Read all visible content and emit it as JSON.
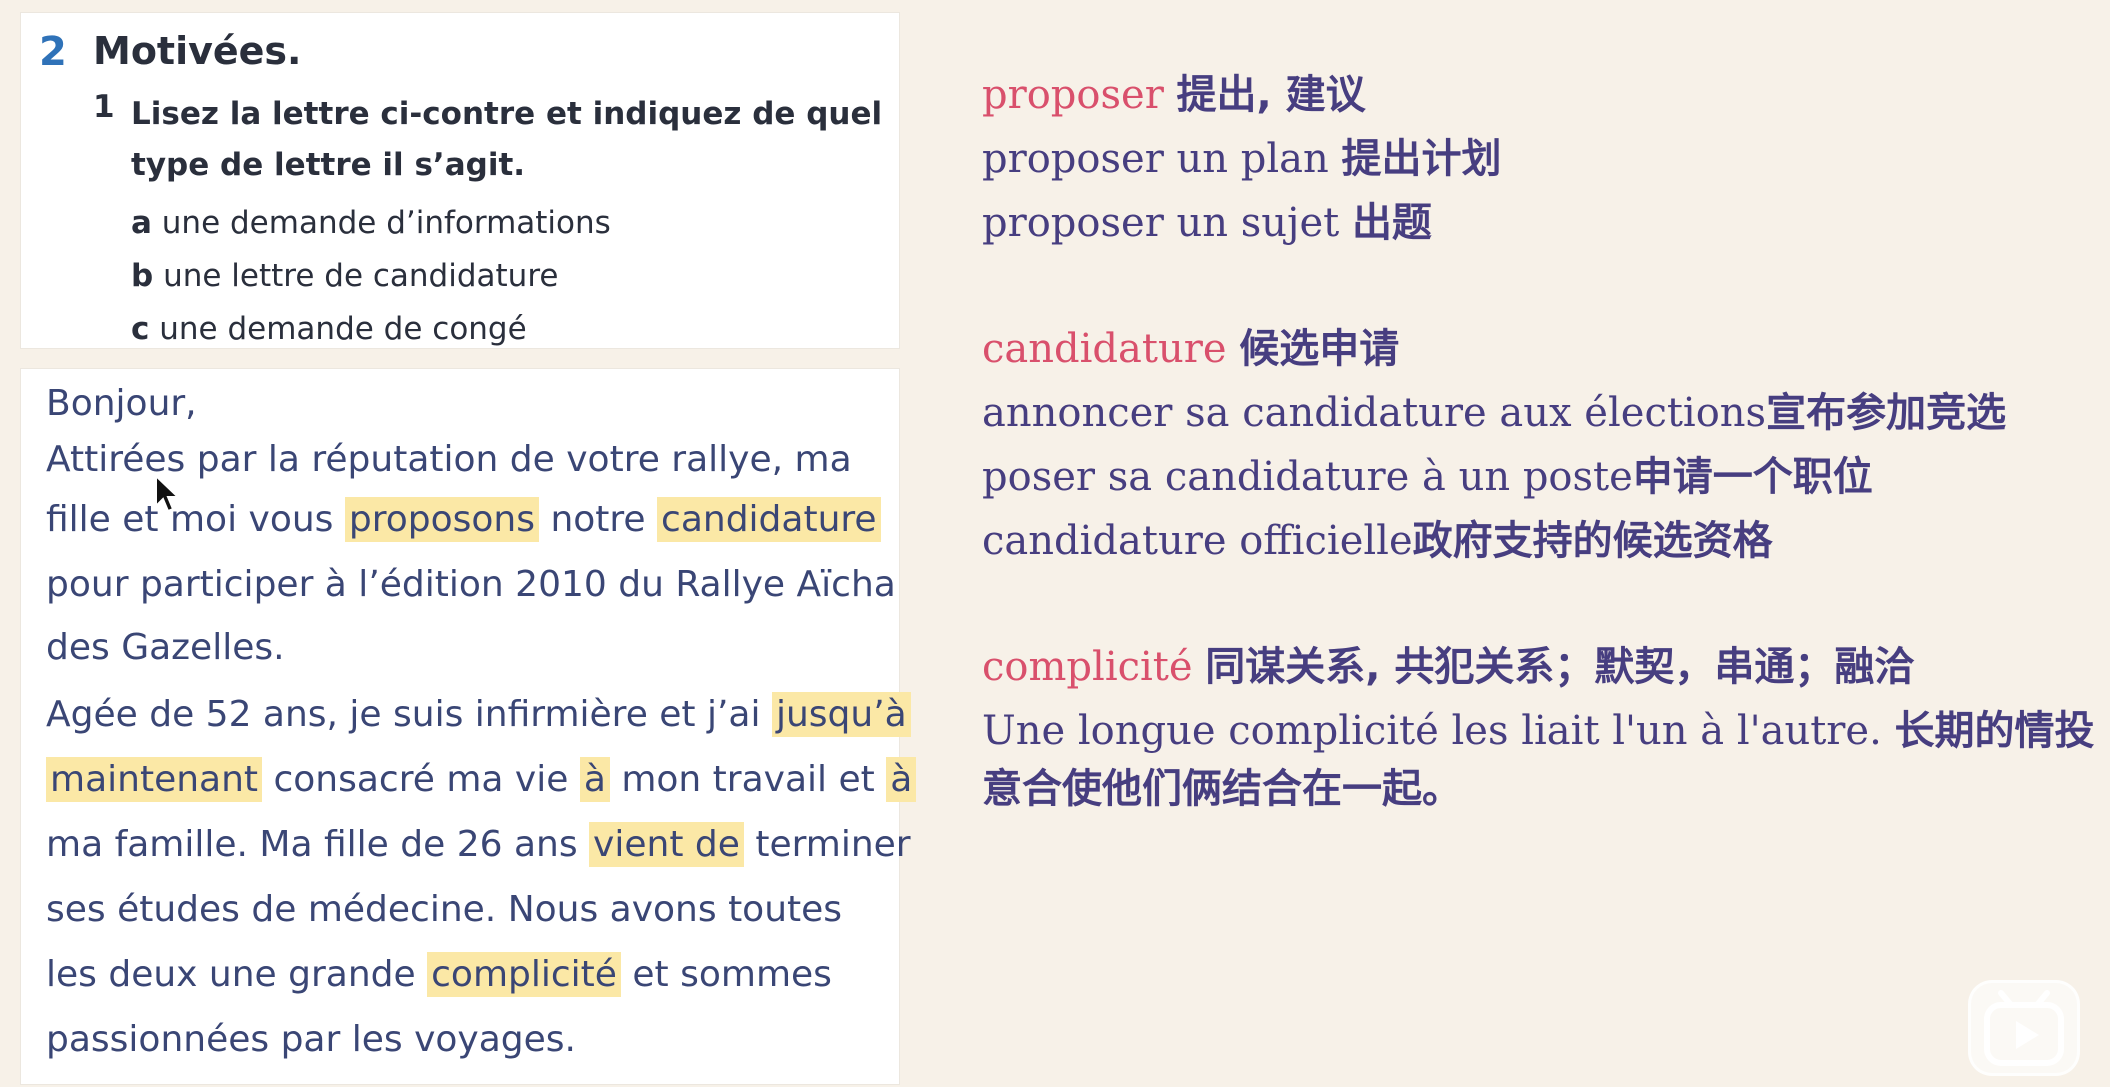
{
  "exercise": {
    "number": "2",
    "title": "Motivées.",
    "question_number": "1",
    "question_text": "Lisez la lettre ci-contre et indiquez de quel type de lettre il s’agit.",
    "options": [
      {
        "letter": "a",
        "text": "une demande d’informations"
      },
      {
        "letter": "b",
        "text": "une lettre de candidature"
      },
      {
        "letter": "c",
        "text": "une demande de congé"
      }
    ]
  },
  "letter": {
    "l1": "Bonjour,",
    "l2": "Attirées par la réputation de votre rallye, ma",
    "l3a": "fille et moi vous",
    "l3b": "proposons",
    "l3c": "notre",
    "l3d": "candidature",
    "l4": "pour participer à l’édition 2010 du Rallye Aïcha",
    "l5": "des Gazelles.",
    "l6a": "Agée de 52 ans, je suis infirmière et j’ai",
    "l6b": "jusqu’à",
    "l7a": "maintenant",
    "l7b": "consacré ma vie",
    "l7c": "à",
    "l7d": "mon travail et",
    "l7e": "à",
    "l8a": "ma famille. Ma fille de 26 ans",
    "l8b": "vient de",
    "l8c": "terminer",
    "l9": "ses études de médecine. Nous avons toutes",
    "l10a": "les deux une grande",
    "l10b": "complicité",
    "l10c": "et sommes",
    "l11": "passionnées par les voyages."
  },
  "vocab": {
    "proposer": {
      "word": "proposer",
      "meaning": "提出, 建议",
      "ex1_fr": "proposer un plan",
      "ex1_zh": "提出计划",
      "ex2_fr": "proposer un sujet",
      "ex2_zh": "出题"
    },
    "candidature": {
      "word": "candidature",
      "meaning": "候选申请",
      "ex1_fr": "annoncer sa candidature aux élections",
      "ex1_zh": "宣布参加竞选",
      "ex2_fr": "poser sa candidature à un poste",
      "ex2_zh": "申请一个职位",
      "ex3_fr": "candidature officielle",
      "ex3_zh": "政府支持的候选资格"
    },
    "complicite": {
      "word": "complicité",
      "meaning": "同谋关系, 共犯关系；默契，串通；融洽",
      "ex1_fr": "Une longue complicité les liait l'un à l'autre.",
      "ex1_zh_a": "长期的情投",
      "ex1_zh_b": "意合使他们俩结合在一起。"
    }
  },
  "colors": {
    "headword": "#d9506c",
    "body_text": "#473e80",
    "highlight": "#fbe8a6",
    "exercise_number": "#2f72b8"
  },
  "icons": [
    "cursor-arrow-icon",
    "play-icon"
  ]
}
